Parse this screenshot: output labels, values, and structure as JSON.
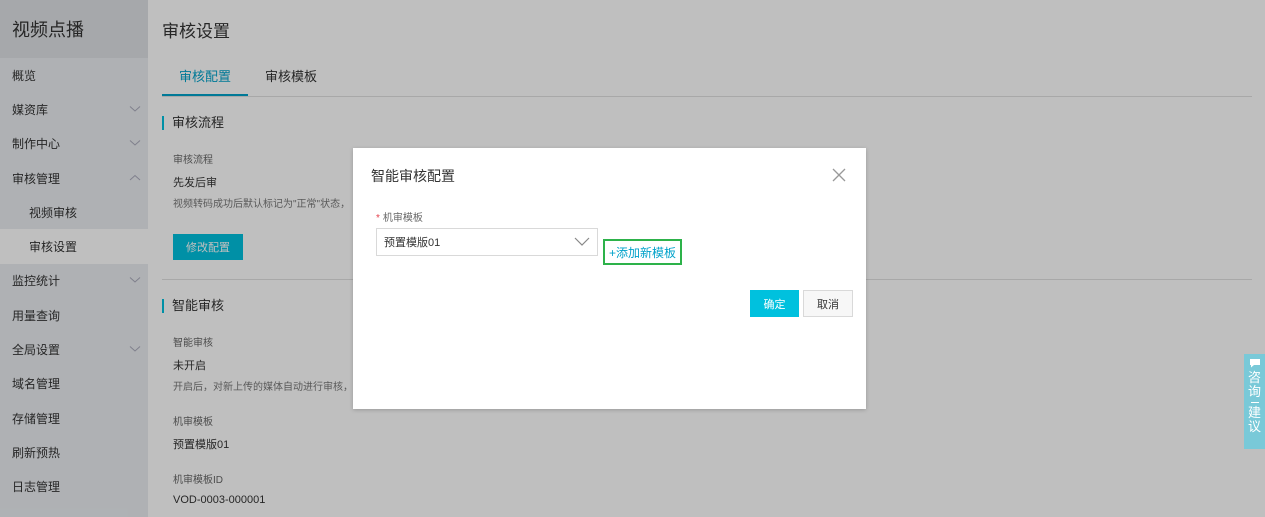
{
  "sidebar": {
    "title": "视频点播",
    "items": [
      {
        "label": "概览",
        "chevron": "none",
        "sub": false,
        "active": false
      },
      {
        "label": "媒资库",
        "chevron": "down",
        "sub": false,
        "active": false
      },
      {
        "label": "制作中心",
        "chevron": "down",
        "sub": false,
        "active": false
      },
      {
        "label": "审核管理",
        "chevron": "up",
        "sub": false,
        "active": false
      },
      {
        "label": "视频审核",
        "chevron": "none",
        "sub": true,
        "active": false
      },
      {
        "label": "审核设置",
        "chevron": "none",
        "sub": true,
        "active": true
      },
      {
        "label": "监控统计",
        "chevron": "down",
        "sub": false,
        "active": false
      },
      {
        "label": "用量查询",
        "chevron": "none",
        "sub": false,
        "active": false
      },
      {
        "label": "全局设置",
        "chevron": "down",
        "sub": false,
        "active": false
      },
      {
        "label": "域名管理",
        "chevron": "none",
        "sub": false,
        "active": false
      },
      {
        "label": "存储管理",
        "chevron": "none",
        "sub": false,
        "active": false
      },
      {
        "label": "刷新预热",
        "chevron": "none",
        "sub": false,
        "active": false
      },
      {
        "label": "日志管理",
        "chevron": "none",
        "sub": false,
        "active": false
      }
    ]
  },
  "main": {
    "title": "审核设置",
    "tabs": [
      {
        "label": "审核配置",
        "active": true
      },
      {
        "label": "审核模板",
        "active": false
      }
    ],
    "flow": {
      "section_title": "审核流程",
      "label": "审核流程",
      "value": "先发后审",
      "desc": "视频转码成功后默认标记为\"正常\"状态，",
      "edit_button": "修改配置"
    },
    "smart": {
      "section_title": "智能审核",
      "label": "智能审核",
      "value": "未开启",
      "desc": "开启后，对新上传的媒体自动进行审核，",
      "template_label": "机审模板",
      "template_value": "预置模版01",
      "template_id_label": "机审模板ID",
      "template_id_value": "VOD-0003-000001"
    }
  },
  "modal": {
    "title": "智能审核配置",
    "required_mark": "*",
    "field_label": "机审模板",
    "select_value": "预置模版01",
    "add_link": "+添加新模板",
    "confirm": "确定",
    "cancel": "取消"
  },
  "consult": {
    "text1": "咨询",
    "text2": "建议"
  },
  "colors": {
    "accent": "#00c1de",
    "link": "#00a2ca",
    "highlight_border": "#2db24a"
  }
}
